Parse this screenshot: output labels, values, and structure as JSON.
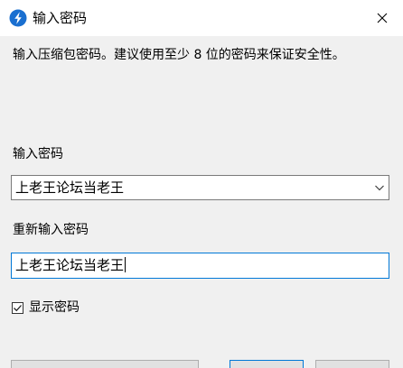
{
  "window": {
    "title": "输入密码",
    "app_icon": "bandizip-icon",
    "close_icon": "close-icon"
  },
  "description": "输入压缩包密码。建议使用至少 8 位的密码来保证安全性。",
  "password": {
    "label": "输入密码",
    "value": "上老王论坛当老王",
    "dropdown_icon": "chevron-down-icon"
  },
  "reenter": {
    "label": "重新输入密码",
    "value": "上老王论坛当老王"
  },
  "show_password": {
    "label": "显示密码",
    "checked": true
  },
  "colors": {
    "focus_border": "#0078d7",
    "app_icon": "#1a6fd0"
  }
}
